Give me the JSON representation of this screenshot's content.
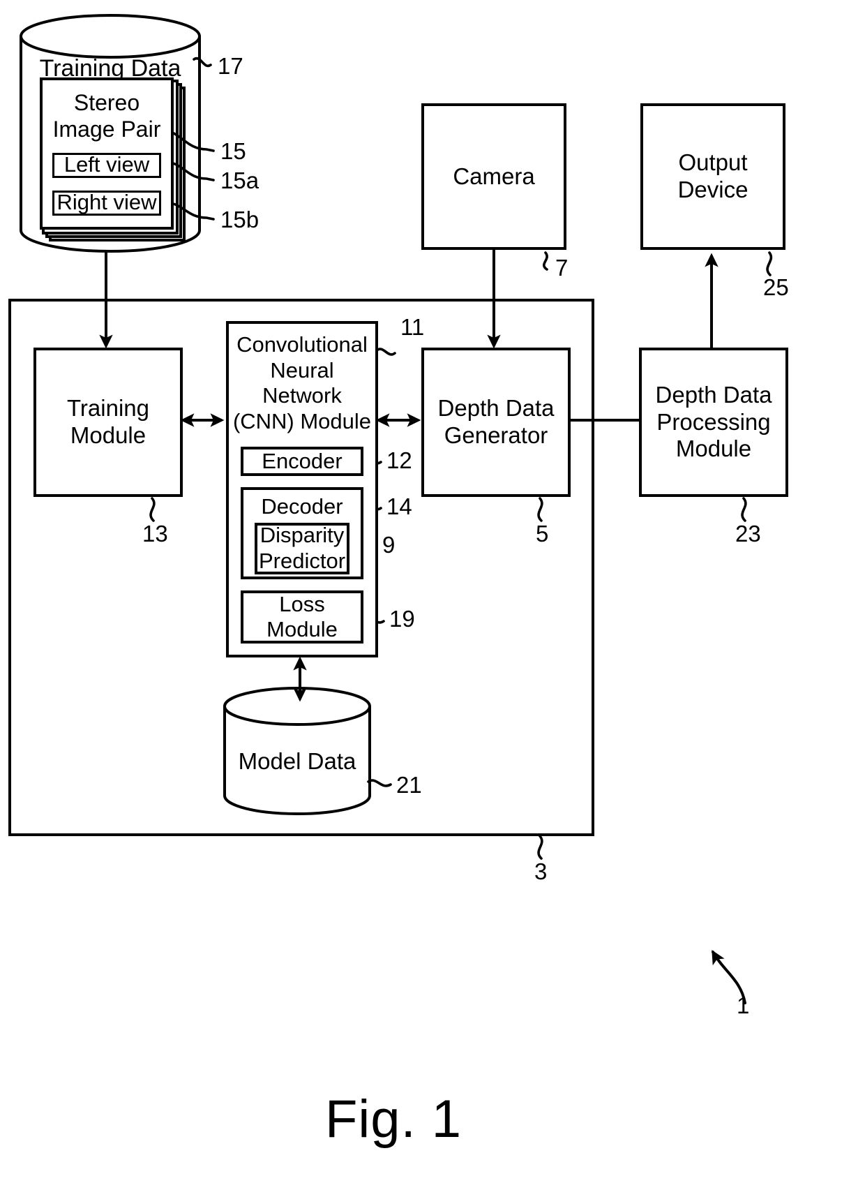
{
  "figure": {
    "caption": "Fig. 1",
    "system_ref": "1",
    "apparatus_ref": "3"
  },
  "training_data_store": {
    "label": "Training Data",
    "ref": "17",
    "stereo_image_pair": {
      "label": "Stereo\nImage Pair",
      "ref": "15",
      "left_view": {
        "label": "Left view",
        "ref": "15a"
      },
      "right_view": {
        "label": "Right view",
        "ref": "15b"
      }
    }
  },
  "camera": {
    "label": "Camera",
    "ref": "7"
  },
  "output_device": {
    "label": "Output Device",
    "ref": "25"
  },
  "training_module": {
    "label": "Training\nModule",
    "ref": "13"
  },
  "cnn_module": {
    "label": "Convolutional\nNeural\nNetwork\n(CNN) Module",
    "ref": "11",
    "encoder": {
      "label": "Encoder",
      "ref": "12"
    },
    "decoder": {
      "label": "Decoder",
      "ref": "14",
      "disparity_predictor": {
        "label": "Disparity\nPredictor",
        "ref": "9"
      }
    },
    "loss_module": {
      "label": "Loss\nModule",
      "ref": "19"
    }
  },
  "model_data_store": {
    "label": "Model Data",
    "ref": "21"
  },
  "depth_data_generator": {
    "label": "Depth Data\nGenerator",
    "ref": "5"
  },
  "depth_data_processing_module": {
    "label": "Depth Data\nProcessing\nModule",
    "ref": "23"
  },
  "colors": {
    "stroke": "#000000",
    "background": "#ffffff"
  }
}
